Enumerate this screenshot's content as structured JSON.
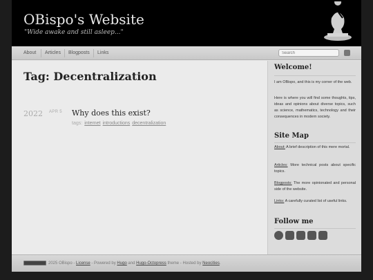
{
  "header": {
    "site_title": "OBispo's Website",
    "subtitle": "\"Wide awake and still asleep...\"",
    "logo_icon": "chess-bishop-icon"
  },
  "nav": {
    "items": [
      {
        "label": "About"
      },
      {
        "label": "Articles"
      },
      {
        "label": "Blogposts"
      },
      {
        "label": "Links"
      }
    ],
    "search_placeholder": "Search",
    "rss_icon": "rss-icon"
  },
  "main": {
    "page_title": "Tag: Decentralization",
    "posts": [
      {
        "year": "2022",
        "date": "APR 5",
        "title": "Why does this exist?",
        "tags_label": "tags:",
        "tags": [
          "internet",
          "introductions",
          "decentralization"
        ]
      }
    ]
  },
  "sidebar": {
    "welcome_title": "Welcome!",
    "welcome_p1": "I am OBispo, and this is my corner of the web.",
    "welcome_p2": "Here is where you will find some thoughts, tips, ideas and opinions about diverse topics, such as science, mathematics, technology and their consequences in modern society.",
    "sitemap_title": "Site Map",
    "sitemap": [
      {
        "link": "About:",
        "text": " A brief description of this mere mortal."
      },
      {
        "link": "Articles:",
        "text": " More technical posts about specific topics."
      },
      {
        "link": "Blogposts:",
        "text": " The more opinionated and personal side of the website."
      },
      {
        "link": "Links:",
        "text": " A carefully curated list of useful links."
      }
    ],
    "follow_title": "Follow me",
    "social_icons": [
      "github-icon",
      "diaspora-icon",
      "mastodon-icon",
      "youtube-icon",
      "rss-icon"
    ]
  },
  "footer": {
    "cc_badge_icon": "cc-by-sa-badge-icon",
    "copyright": "2025 OBispo -",
    "license_link": "License",
    "powered_text": " - Powered by ",
    "hugo_link": "Hugo",
    "and_text": " and ",
    "theme_link": "Hugo-Octopress",
    "hosted_text": " theme - Hosted by ",
    "host_link": "Neocities",
    "end_text": "."
  }
}
